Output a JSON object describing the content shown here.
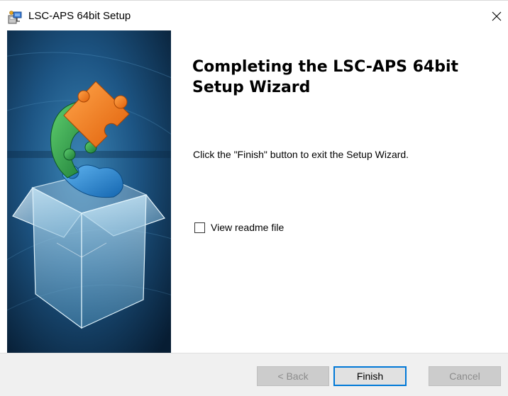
{
  "window": {
    "title": "LSC-APS 64bit Setup",
    "close_symbol": "×",
    "app_icon": "installer-package-icon",
    "close_icon": "close-icon"
  },
  "banner": {
    "graphics": [
      "puzzle-piece-orange",
      "puzzle-piece-green",
      "puzzle-piece-blue",
      "open-box-icon"
    ]
  },
  "main": {
    "heading": "Completing the LSC-APS 64bit Setup Wizard",
    "description": "Click the \"Finish\" button to exit the Setup Wizard.",
    "readme_checkbox": {
      "label": "View readme file",
      "checked": false
    }
  },
  "footer": {
    "back_label": "< Back",
    "finish_label": "Finish",
    "cancel_label": "Cancel",
    "back_enabled": false,
    "cancel_enabled": false
  },
  "colors": {
    "focus_border": "#0078d7",
    "footer_bg": "#f0f0f0",
    "banner_dark": "#0a2a45",
    "banner_light": "#2d6f9c",
    "puzzle_orange": "#f07c1a",
    "puzzle_green": "#2e9c4c",
    "puzzle_blue": "#2b8fd6"
  }
}
